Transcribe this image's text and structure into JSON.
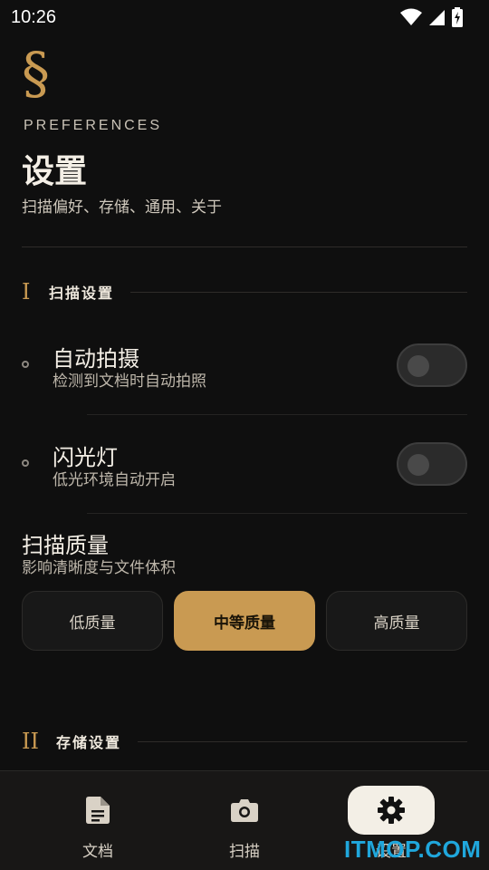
{
  "status_bar": {
    "time": "10:26"
  },
  "header": {
    "mark": "§",
    "eyebrow": "PREFERENCES",
    "title": "设置",
    "subtitle": "扫描偏好、存储、通用、关于"
  },
  "sections": [
    {
      "numeral": "I",
      "label": "扫描设置"
    },
    {
      "numeral": "II",
      "label": "存储设置"
    }
  ],
  "scan_settings": {
    "auto_capture": {
      "title": "自动拍摄",
      "desc": "检测到文档时自动拍照",
      "enabled": false
    },
    "flash": {
      "title": "闪光灯",
      "desc": "低光环境自动开启",
      "enabled": false
    },
    "quality": {
      "title": "扫描质量",
      "desc": "影响清晰度与文件体积",
      "options": [
        "低质量",
        "中等质量",
        "高质量"
      ],
      "selected": "中等质量"
    }
  },
  "bottom_nav": {
    "items": [
      {
        "label": "文档",
        "icon": "document-icon",
        "active": false
      },
      {
        "label": "扫描",
        "icon": "camera-icon",
        "active": false
      },
      {
        "label": "设置",
        "icon": "gear-icon",
        "active": true
      }
    ]
  },
  "watermark": "ITMOP.COM",
  "colors": {
    "background": "#0f0f0f",
    "accent": "#c99a52",
    "nav_active_pill": "#f3efe6"
  }
}
